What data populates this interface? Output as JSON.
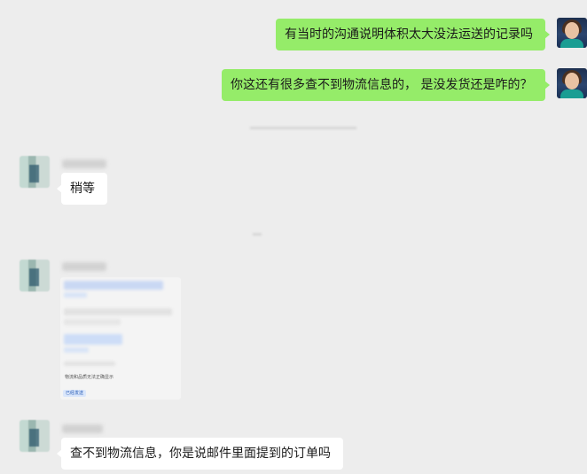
{
  "messages": {
    "m1": {
      "text": "有当时的沟通说明体积太大没法运送的记录吗",
      "sender": "self"
    },
    "m2": {
      "text": "你这还有很多查不到物流信息的， 是没发货还是咋的？",
      "sender": "self"
    },
    "m3": {
      "text": "稍等",
      "sender": "other"
    },
    "m4": {
      "type": "image",
      "caption_line": "物流和品质无法正确显示",
      "button_line": "已经发送"
    },
    "m5": {
      "text": "查不到物流信息，你是说邮件里面提到的订单吗",
      "sender": "other"
    }
  },
  "colors": {
    "background": "#ededed",
    "outgoing_bubble": "#95ec69",
    "incoming_bubble": "#ffffff"
  },
  "icons": {
    "self_avatar": "user-avatar-icon",
    "other_avatar": "contact-avatar-icon"
  }
}
